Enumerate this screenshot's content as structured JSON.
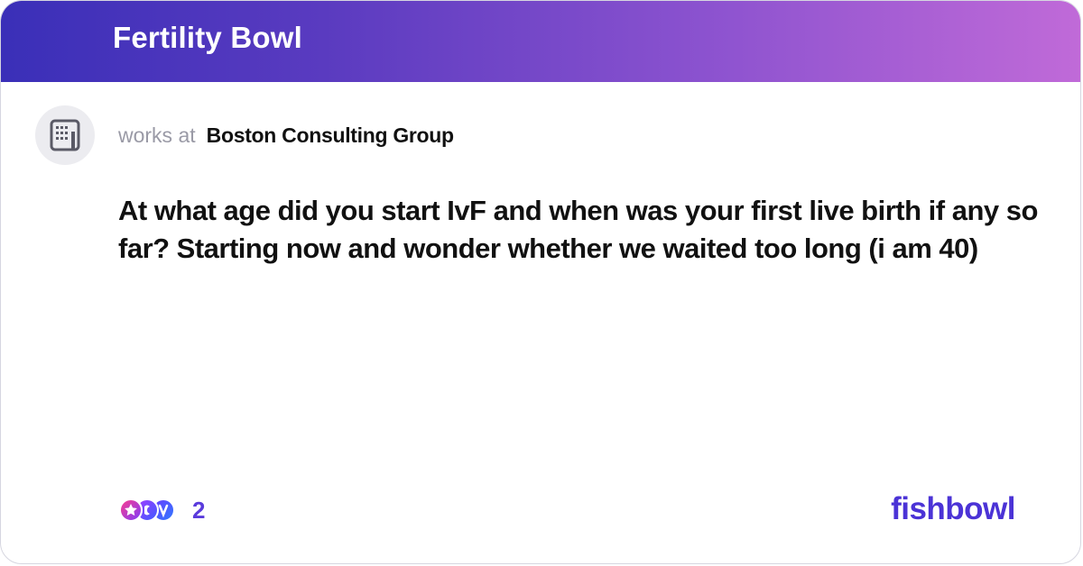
{
  "header": {
    "bowl_name": "Fertility Bowl"
  },
  "post": {
    "works_at_label": "works at",
    "company": "Boston Consulting Group",
    "question": "At what age did you start IvF and when was your first live birth if any so far? Starting now and wonder whether we waited too long (i am 40)"
  },
  "footer": {
    "reaction_count": "2",
    "brand": "fishbowl"
  },
  "icons": {
    "company": "building-icon",
    "reactions": "reaction-emojis-icon"
  },
  "colors": {
    "header_gradient_start": "#3a2fb8",
    "header_gradient_end": "#c06ad8",
    "accent": "#4b33d6"
  }
}
